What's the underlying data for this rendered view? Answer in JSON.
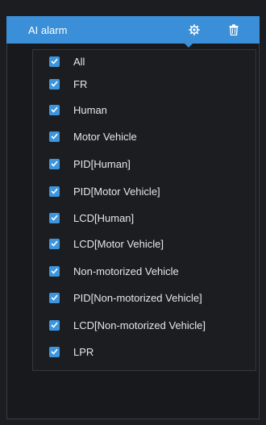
{
  "header": {
    "title": "AI alarm",
    "icons": [
      "gear-icon",
      "trash-icon"
    ],
    "accent_color": "#3a8fd8"
  },
  "options": [
    {
      "label": "All",
      "checked": true
    },
    {
      "label": "FR",
      "checked": true
    },
    {
      "label": "Human",
      "checked": true
    },
    {
      "label": "Motor Vehicle",
      "checked": true
    },
    {
      "label": "PID[Human]",
      "checked": true
    },
    {
      "label": "PID[Motor Vehicle]",
      "checked": true
    },
    {
      "label": "LCD[Human]",
      "checked": true
    },
    {
      "label": "LCD[Motor Vehicle]",
      "checked": true
    },
    {
      "label": "Non-motorized Vehicle",
      "checked": true
    },
    {
      "label": "PID[Non-motorized Vehicle]",
      "checked": true
    },
    {
      "label": "LCD[Non-motorized Vehicle]",
      "checked": true
    },
    {
      "label": "LPR",
      "checked": true
    }
  ],
  "colors": {
    "checkbox": "#3d95de",
    "background": "#1b1d20"
  }
}
